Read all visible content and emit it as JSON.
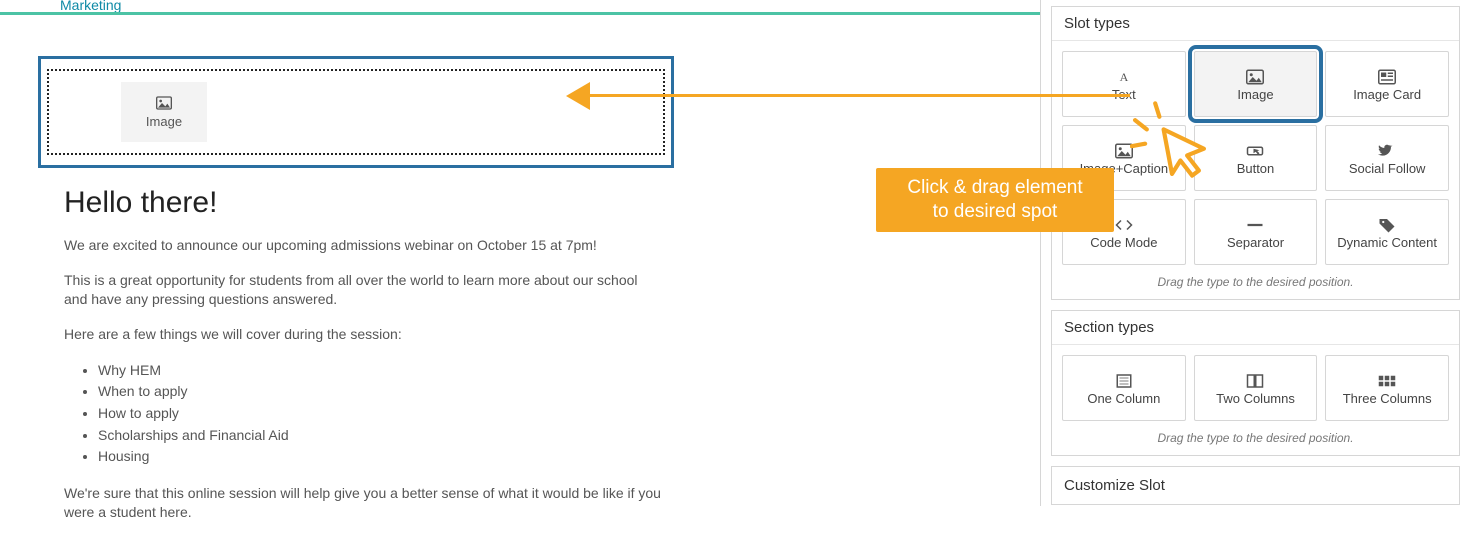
{
  "nav": {
    "label": "Marketing"
  },
  "drop_target": {
    "chip_label": "Image"
  },
  "content": {
    "heading": "Hello there!",
    "p1": "We are excited to announce our upcoming admissions webinar on October 15 at 7pm!",
    "p2": "This is a great opportunity for students from all over the world to learn more about our school and have any pressing questions answered.",
    "p3": "Here are a few things we will cover during the session:",
    "bullets": [
      "Why HEM",
      "When to apply",
      "How to apply",
      "Scholarships and Financial Aid",
      "Housing"
    ],
    "p4": "We're sure that this online session will help give you a better sense of what it would be like if you were a student here."
  },
  "panels": {
    "slot_title": "Slot types",
    "section_title": "Section types",
    "customize_title": "Customize Slot",
    "hint": "Drag the type to the desired position."
  },
  "slot_types": [
    {
      "label": "Text",
      "icon": "text"
    },
    {
      "label": "Image",
      "icon": "image",
      "selected": true
    },
    {
      "label": "Image Card",
      "icon": "card"
    },
    {
      "label": "Image+Caption",
      "icon": "image"
    },
    {
      "label": "Button",
      "icon": "button"
    },
    {
      "label": "Social Follow",
      "icon": "social"
    },
    {
      "label": "Code Mode",
      "icon": "code"
    },
    {
      "label": "Separator",
      "icon": "sep"
    },
    {
      "label": "Dynamic Content",
      "icon": "tag"
    }
  ],
  "section_types": [
    {
      "label": "One Column",
      "icon": "col1"
    },
    {
      "label": "Two Columns",
      "icon": "col2"
    },
    {
      "label": "Three Columns",
      "icon": "col3"
    }
  ],
  "callout": {
    "line1": "Click & drag element",
    "line2": "to desired spot"
  }
}
